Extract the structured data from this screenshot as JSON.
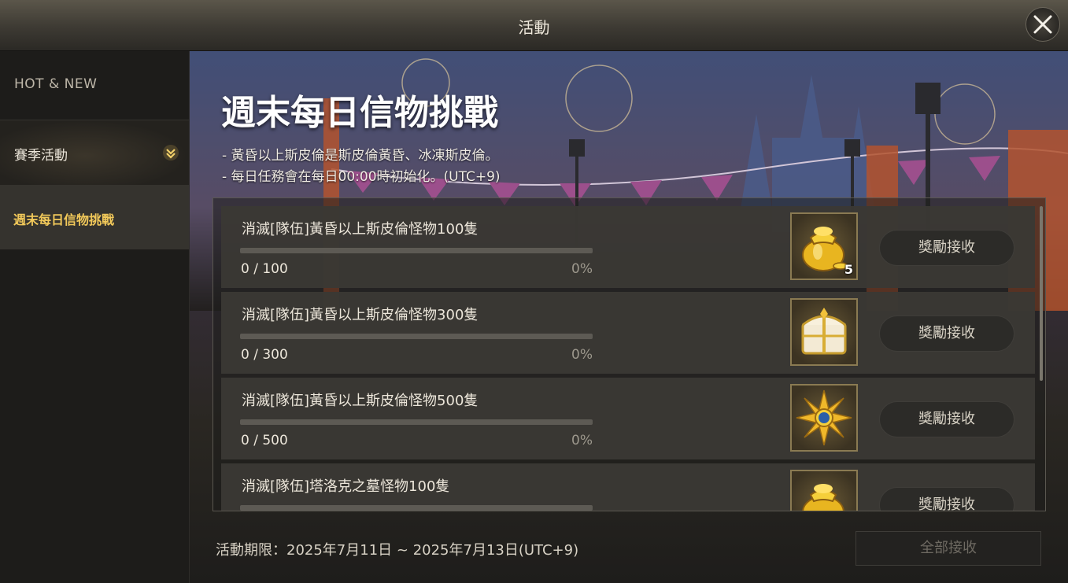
{
  "window": {
    "title": "活動",
    "close_icon": "close-x-icon"
  },
  "sidebar": {
    "section_label": "HOT & NEW",
    "category": {
      "label": "賽季活動",
      "icon": "chevron-down-icon"
    },
    "selected_item": {
      "label": "週末每日信物挑戰"
    }
  },
  "event": {
    "title": "週末每日信物挑戰",
    "description": [
      "- 黃昏以上斯皮倫是斯皮倫黃昏、冰凍斯皮倫。",
      "- 每日任務會在每日00:00時初始化。(UTC+9)"
    ],
    "quests": [
      {
        "name": "消滅[隊伍]黃昏以上斯皮倫怪物100隻",
        "count": "0 / 100",
        "percent": "0%",
        "progress": 0,
        "reward_icon": "gold-pouch-icon",
        "reward_qty": "5",
        "claim_label": "獎勵接收"
      },
      {
        "name": "消滅[隊伍]黃昏以上斯皮倫怪物300隻",
        "count": "0 / 300",
        "percent": "0%",
        "progress": 0,
        "reward_icon": "treasure-chest-icon",
        "reward_qty": "",
        "claim_label": "獎勵接收"
      },
      {
        "name": "消滅[隊伍]黃昏以上斯皮倫怪物500隻",
        "count": "0 / 500",
        "percent": "0%",
        "progress": 0,
        "reward_icon": "sun-emblem-icon",
        "reward_qty": "",
        "claim_label": "獎勵接收"
      },
      {
        "name": "消滅[隊伍]塔洛克之墓怪物100隻",
        "count": "",
        "percent": "",
        "progress": 0,
        "reward_icon": "gold-pouch-icon",
        "reward_qty": "",
        "claim_label": "獎勵接收"
      }
    ],
    "period": "活動期限：2025年7月11日 ~ 2025年7月13日(UTC+9)",
    "claim_all_label": "全部接收"
  },
  "colors": {
    "accent": "#f2c95a",
    "panel": "#3a3834",
    "bar": "#5d5a54"
  }
}
